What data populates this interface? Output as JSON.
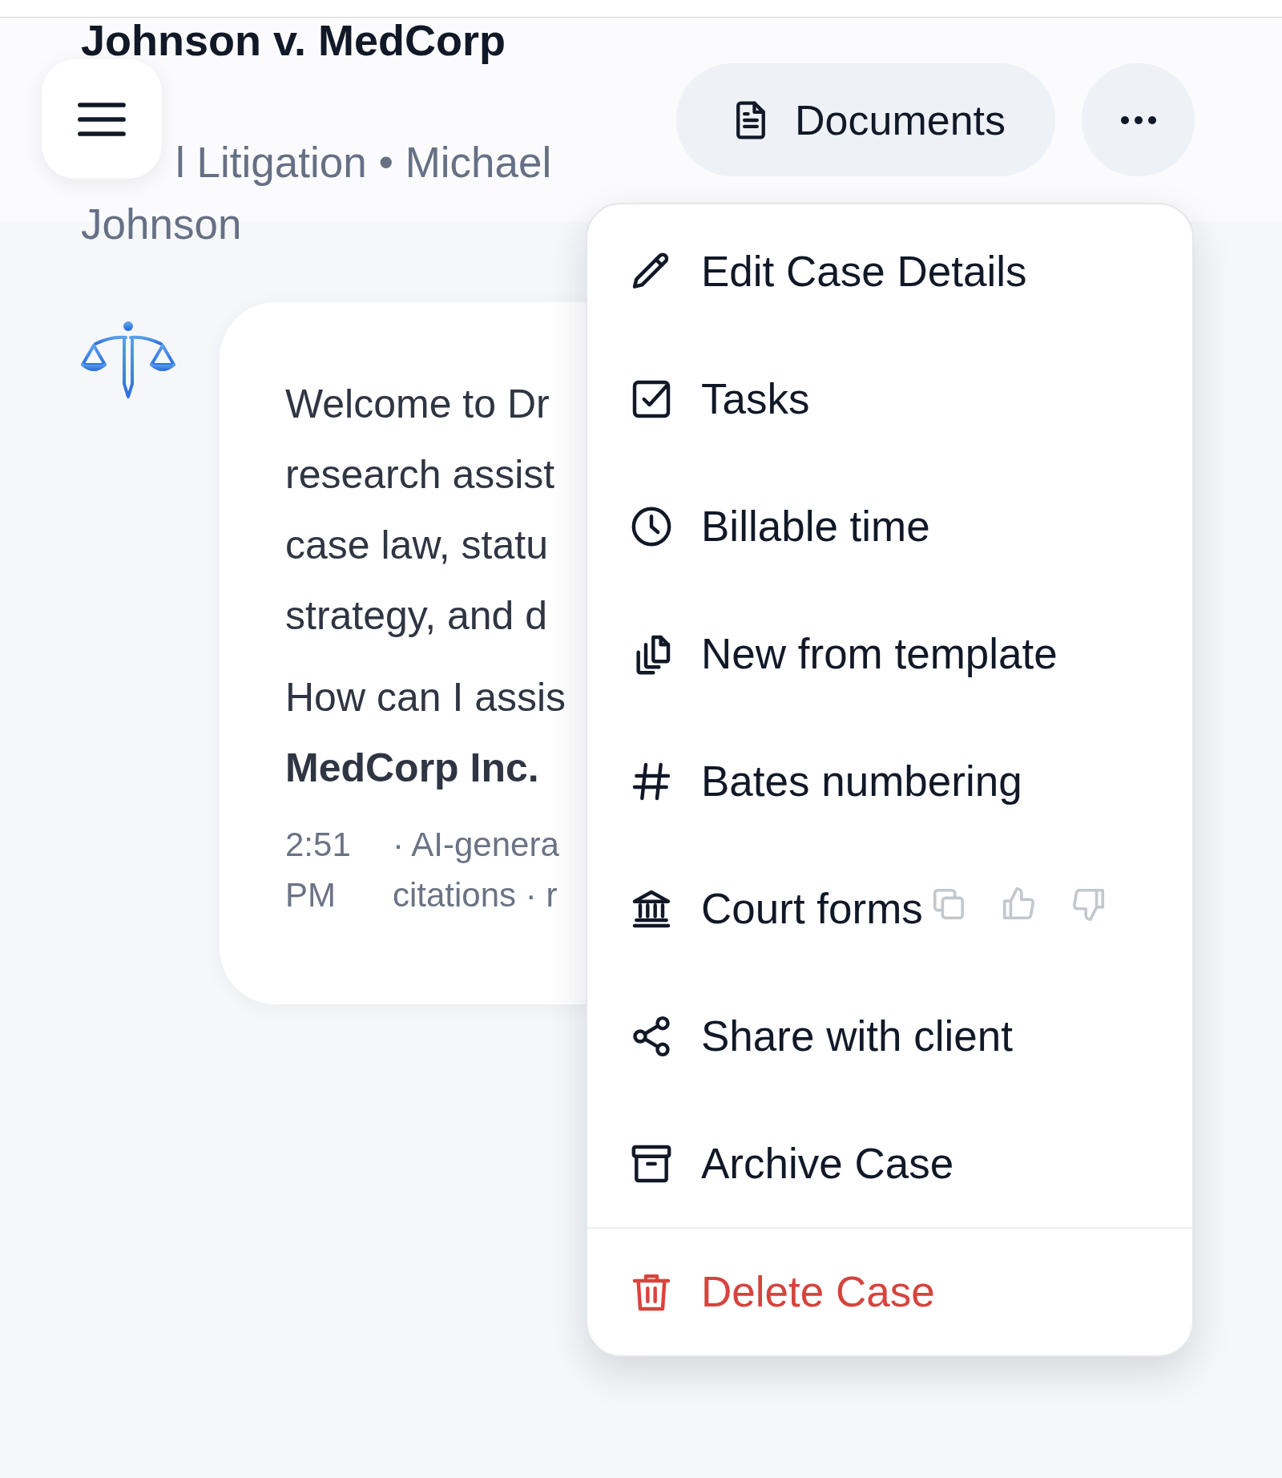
{
  "header": {
    "title": "Johnson v. MedCorp",
    "subtitle": "l Litigation • Michael Johnson",
    "documents_button": "Documents"
  },
  "message": {
    "paragraphs": [
      {
        "lines": [
          "Welcome to Dr",
          "research assist",
          "case law, statu",
          "strategy, and d"
        ]
      },
      {
        "lines": [
          "How can I assis",
          "**MedCorp Inc.**"
        ]
      }
    ],
    "time": "2:51 PM",
    "meta_lines": [
      "· AI-genera",
      "citations · r"
    ]
  },
  "menu": {
    "items": [
      {
        "label": "Edit Case Details",
        "kind": "edit",
        "danger": false
      },
      {
        "label": "Tasks",
        "kind": "tasks",
        "danger": false
      },
      {
        "label": "Billable time",
        "kind": "time",
        "danger": false
      },
      {
        "label": "New from template",
        "kind": "template",
        "danger": false
      },
      {
        "label": "Bates numbering",
        "kind": "number",
        "danger": false
      },
      {
        "label": "Court forms",
        "kind": "court",
        "danger": false
      },
      {
        "label": "Share with client",
        "kind": "share",
        "danger": false
      },
      {
        "label": "Archive Case",
        "kind": "archive",
        "danger": false
      },
      {
        "label": "Delete Case",
        "kind": "delete",
        "danger": true
      }
    ]
  }
}
